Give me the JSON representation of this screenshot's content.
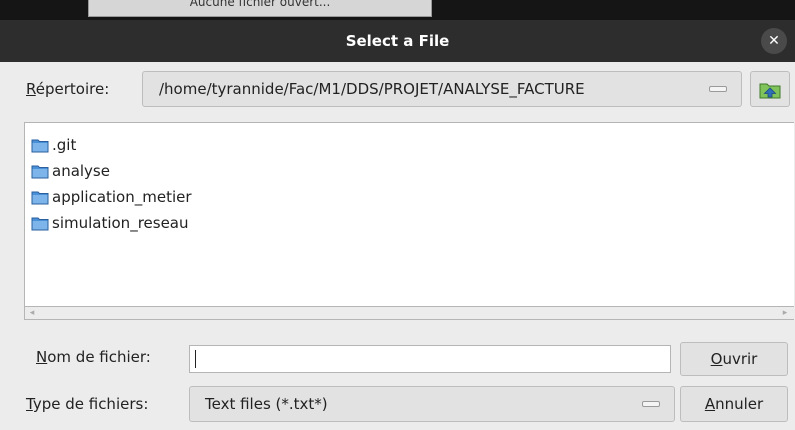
{
  "background": {
    "tab_text": "Aucune fichier ouvert..."
  },
  "dialog": {
    "title": "Select a File",
    "close_icon": "close-icon",
    "directory": {
      "label_underlined": "R",
      "label_rest": "épertoire:",
      "path": "/home/tyrannide/Fac/M1/DDS/PROJET/ANALYSE_FACTURE",
      "up_icon": "folder-up-icon"
    },
    "files": [
      {
        "name": ".git",
        "icon": "folder-icon"
      },
      {
        "name": "analyse",
        "icon": "folder-icon"
      },
      {
        "name": "application_metier",
        "icon": "folder-icon"
      },
      {
        "name": "simulation_reseau",
        "icon": "folder-icon"
      }
    ],
    "filename": {
      "label_underlined": "N",
      "label_rest": "om de fichier:",
      "value": ""
    },
    "filetype": {
      "label_underlined": "T",
      "label_rest": "ype de fichiers:",
      "selected": "Text files (*.txt*)"
    },
    "buttons": {
      "open_underlined": "O",
      "open_rest": "uvrir",
      "cancel_underlined": "A",
      "cancel_rest": "nnuler"
    },
    "colors": {
      "titlebar": "#2d2d2d",
      "dialog_bg": "#ececec",
      "folder_blue": "#4a90d9"
    }
  }
}
